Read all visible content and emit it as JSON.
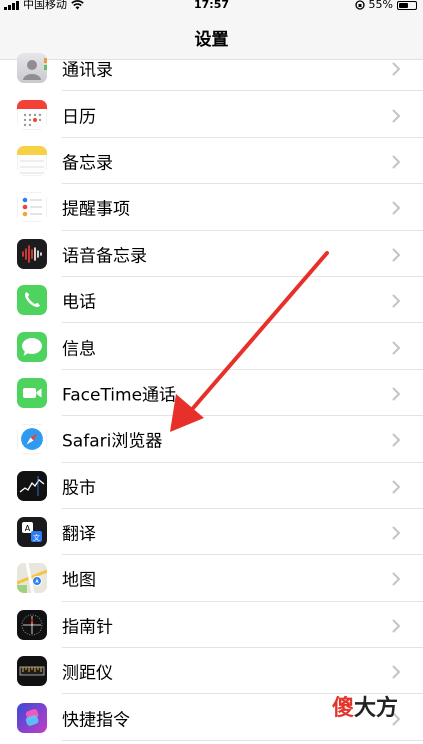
{
  "status": {
    "carrier": "中国移动",
    "time": "17:57",
    "battery": "55%",
    "battery_level": 0.55
  },
  "nav": {
    "title": "设置"
  },
  "items": [
    {
      "label": "通讯录",
      "icon": "contacts-icon"
    },
    {
      "label": "日历",
      "icon": "calendar-icon"
    },
    {
      "label": "备忘录",
      "icon": "notes-icon"
    },
    {
      "label": "提醒事项",
      "icon": "reminders-icon"
    },
    {
      "label": "语音备忘录",
      "icon": "voice-memos-icon"
    },
    {
      "label": "电话",
      "icon": "phone-icon"
    },
    {
      "label": "信息",
      "icon": "messages-icon"
    },
    {
      "label": "FaceTime通话",
      "icon": "facetime-icon"
    },
    {
      "label": "Safari浏览器",
      "icon": "safari-icon"
    },
    {
      "label": "股市",
      "icon": "stocks-icon"
    },
    {
      "label": "翻译",
      "icon": "translate-icon"
    },
    {
      "label": "地图",
      "icon": "maps-icon"
    },
    {
      "label": "指南针",
      "icon": "compass-icon"
    },
    {
      "label": "测距仪",
      "icon": "measure-icon"
    },
    {
      "label": "快捷指令",
      "icon": "shortcuts-icon"
    }
  ],
  "watermark": {
    "part1": "傻",
    "part2": "大方"
  },
  "colors": {
    "annotation_arrow": "#e8302a",
    "chevron": "#c4c4c7",
    "separator": "#e3e3e6"
  }
}
